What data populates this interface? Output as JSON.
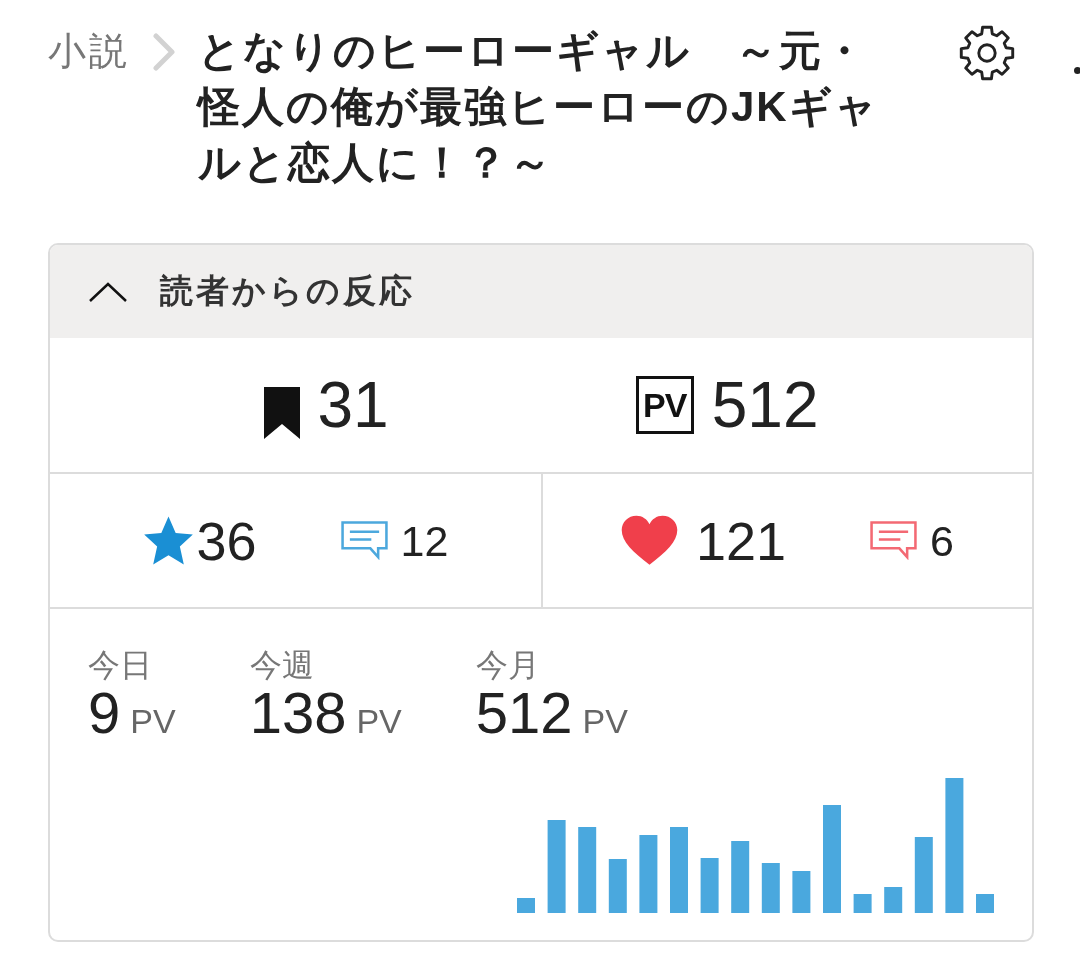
{
  "header": {
    "breadcrumb": "小説",
    "title": "となりのヒーローギャル　～元・怪人の俺が最強ヒーローのJKギャルと恋人に！？～"
  },
  "reactions": {
    "title": "読者からの反応",
    "expanded": true,
    "totals": [
      {
        "kind": "bookmark",
        "count": "31"
      },
      {
        "kind": "pv",
        "badge": "PV",
        "count": "512"
      }
    ],
    "ratings": [
      {
        "kind": "star",
        "count": "36",
        "comments": "12",
        "color": "#1a8fd4"
      },
      {
        "kind": "heart",
        "count": "121",
        "comments": "6",
        "color": "#f03f4b"
      }
    ],
    "periods": [
      {
        "label": "今日",
        "value": "9",
        "unit": "PV"
      },
      {
        "label": "今週",
        "value": "138",
        "unit": "PV"
      },
      {
        "label": "今月",
        "value": "512",
        "unit": "PV"
      }
    ]
  }
}
